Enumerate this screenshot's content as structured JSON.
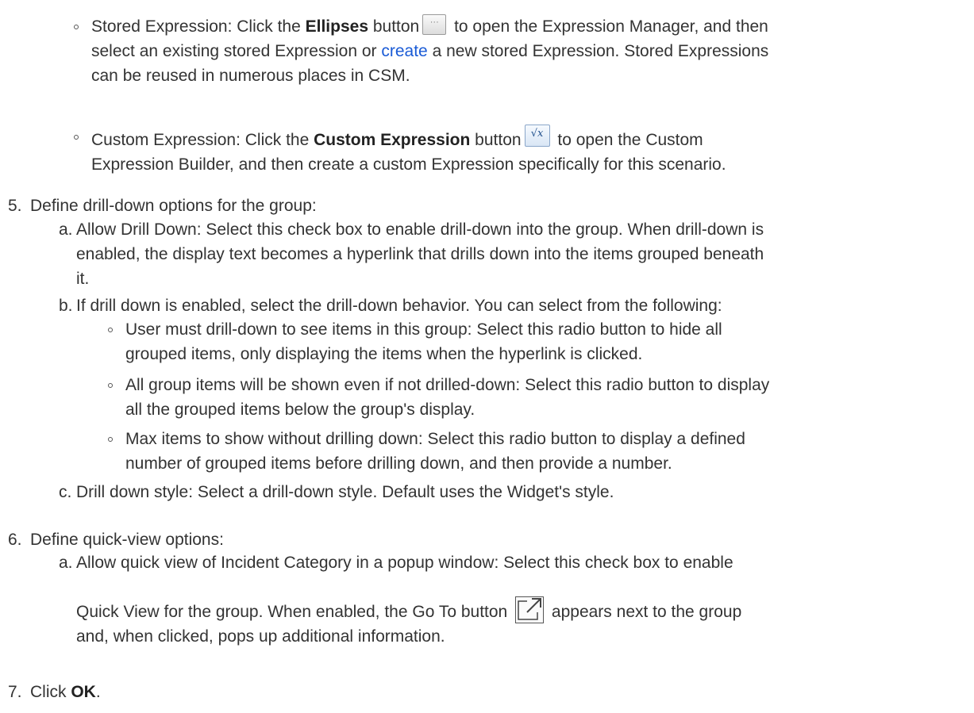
{
  "item_stored": {
    "pre": "Stored Expression: Click the ",
    "bold": "Ellipses",
    "mid": " button",
    "post1": " to open the Expression Manager, and then",
    "line2_pre": "select an existing stored Expression or ",
    "link": "create",
    "line2_post": " a new stored Expression. Stored Expressions",
    "line3": "can be reused in numerous places in CSM."
  },
  "item_custom": {
    "pre": "Custom Expression: Click the ",
    "bold": "Custom Expression",
    "mid": " button",
    "post1": " to open the Custom",
    "line2": "Expression Builder, and then create a custom Expression specifically for this scenario."
  },
  "step5": {
    "num": "5.",
    "text": "Define drill-down options for the group:",
    "a": {
      "letter": "a.",
      "line1": "Allow Drill Down: Select this check box to enable drill-down into the group. When drill-down is",
      "line2": "enabled, the display text becomes a hyperlink that drills down into the items grouped beneath",
      "line3": "it."
    },
    "b": {
      "letter": "b.",
      "text": "If drill down is enabled, select the drill-down behavior. You can select from the following:",
      "opt1_line1": "User must drill-down to see items in this group: Select this radio button to hide all",
      "opt1_line2": "grouped items, only displaying the items when the hyperlink is clicked.",
      "opt2_line1": "All group items will be shown even if not drilled-down: Select this radio button to display",
      "opt2_line2": "all the grouped items below the group's display.",
      "opt3_line1": "Max items to show without drilling down: Select this radio button to display a defined",
      "opt3_line2": "number of grouped items before drilling down, and then provide a number."
    },
    "c": {
      "letter": "c.",
      "text": "Drill down style: Select a drill-down style. Default uses the Widget's style."
    }
  },
  "step6": {
    "num": "6.",
    "text": "Define quick-view options:",
    "a": {
      "letter": "a.",
      "line1": "Allow quick view of Incident Category in a popup window: Select this check box to enable",
      "line2_pre": "Quick View for the group. When enabled, the Go To button",
      "line2_post": " appears next to the group",
      "line3": "and, when clicked, pops up additional information."
    }
  },
  "step7": {
    "num": "7.",
    "pre": "Click ",
    "bold": "OK",
    "post": "."
  },
  "icons": {
    "ellipses_glyph": "···",
    "fx_glyph": "√x"
  },
  "colors": {
    "link": "#1a5bd6",
    "text": "#333333"
  }
}
